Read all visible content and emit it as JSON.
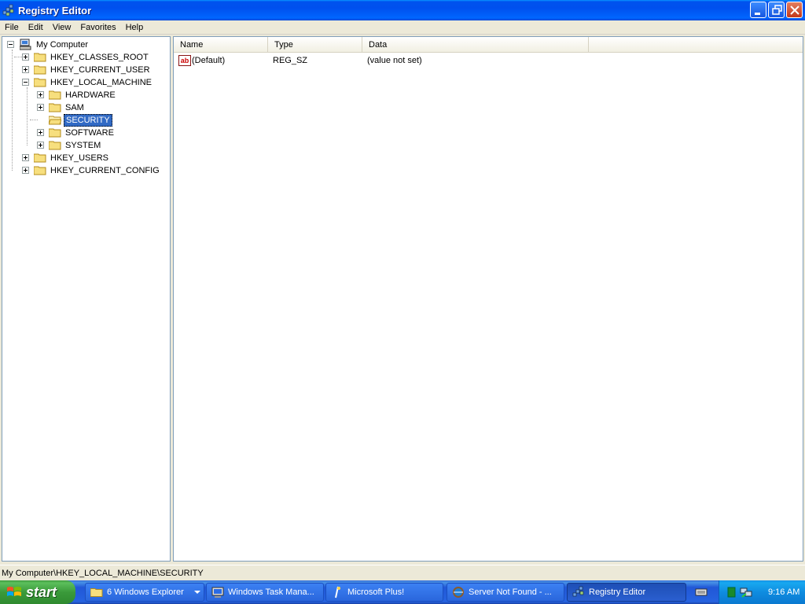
{
  "window": {
    "title": "Registry Editor",
    "icon": "registry-editor-icon"
  },
  "menu": {
    "items": [
      {
        "label": "File"
      },
      {
        "label": "Edit"
      },
      {
        "label": "View"
      },
      {
        "label": "Favorites"
      },
      {
        "label": "Help"
      }
    ]
  },
  "tree": {
    "root": {
      "label": "My Computer",
      "icon": "computer-icon",
      "expanded": true
    },
    "nodes": [
      {
        "label": "HKEY_CLASSES_ROOT",
        "level": 1,
        "expandable": true,
        "expanded": false
      },
      {
        "label": "HKEY_CURRENT_USER",
        "level": 1,
        "expandable": true,
        "expanded": false
      },
      {
        "label": "HKEY_LOCAL_MACHINE",
        "level": 1,
        "expandable": true,
        "expanded": true
      },
      {
        "label": "HARDWARE",
        "level": 2,
        "expandable": true,
        "expanded": false
      },
      {
        "label": "SAM",
        "level": 2,
        "expandable": true,
        "expanded": false
      },
      {
        "label": "SECURITY",
        "level": 2,
        "expandable": false,
        "expanded": false,
        "selected": true
      },
      {
        "label": "SOFTWARE",
        "level": 2,
        "expandable": true,
        "expanded": false
      },
      {
        "label": "SYSTEM",
        "level": 2,
        "expandable": true,
        "expanded": false
      },
      {
        "label": "HKEY_USERS",
        "level": 1,
        "expandable": true,
        "expanded": false
      },
      {
        "label": "HKEY_CURRENT_CONFIG",
        "level": 1,
        "expandable": true,
        "expanded": false
      }
    ]
  },
  "list": {
    "columns": [
      "Name",
      "Type",
      "Data"
    ],
    "rows": [
      {
        "icon": "string-value-icon",
        "name": "(Default)",
        "type": "REG_SZ",
        "data": "(value not set)"
      }
    ]
  },
  "status": {
    "path": "My Computer\\HKEY_LOCAL_MACHINE\\SECURITY"
  },
  "taskbar": {
    "start_label": "start",
    "buttons": [
      {
        "label": "6 Windows Explorer",
        "icon": "folder-icon",
        "group": true
      },
      {
        "label": "Windows Task Mana...",
        "icon": "task-manager-icon"
      },
      {
        "label": "Microsoft Plus!",
        "icon": "plus-icon"
      },
      {
        "label": "Server Not Found - ...",
        "icon": "browser-icon"
      },
      {
        "label": "Registry Editor",
        "icon": "registry-editor-icon",
        "active": true
      }
    ],
    "clock": "9:16 AM"
  },
  "colors": {
    "titlebar": "#0054e3",
    "selection": "#316ac5",
    "taskbar": "#245edb",
    "start": "#3c9a3c",
    "tray": "#0f8ce0"
  }
}
